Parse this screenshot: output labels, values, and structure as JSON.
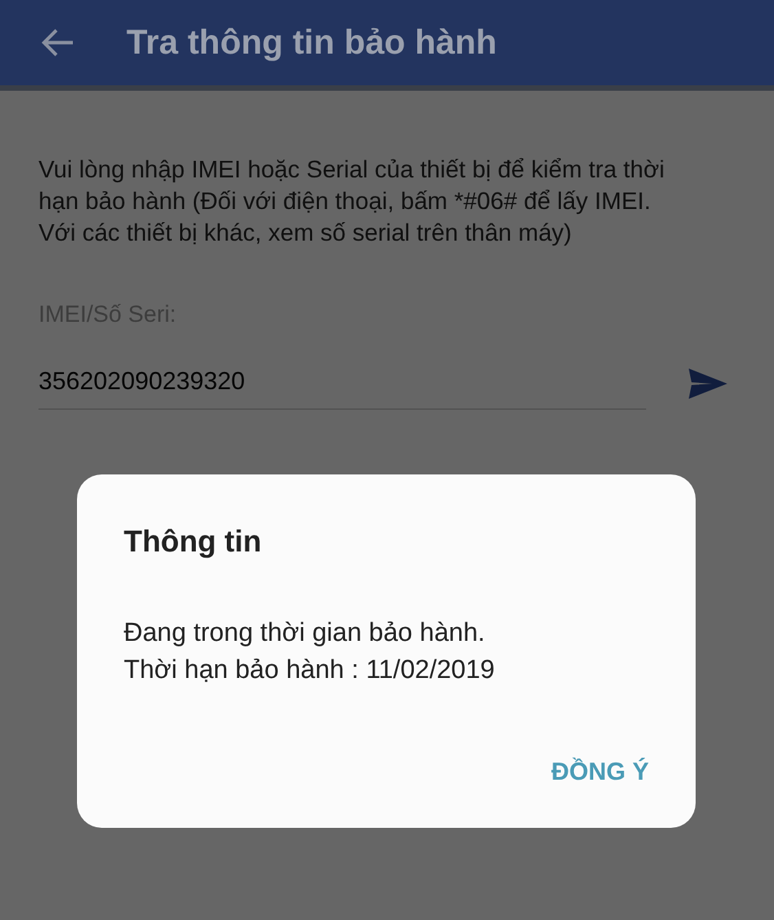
{
  "app_bar": {
    "title": "Tra thông tin bảo hành"
  },
  "instructions": "Vui lòng nhập IMEI hoặc Serial của thiết bị để kiểm tra thời hạn bảo hành (Đối với điện thoại, bấm *#06# để lấy IMEI. Với các thiết bị khác, xem số serial trên thân máy)",
  "imei_field": {
    "label": "IMEI/Số Seri:",
    "value": "356202090239320"
  },
  "dialog": {
    "title": "Thông tin",
    "message_lines": [
      "Đang trong thời gian bảo hành.",
      "Thời hạn bảo hành : 11/02/2019"
    ],
    "buttons": [
      "ĐỒNG Ý"
    ]
  }
}
